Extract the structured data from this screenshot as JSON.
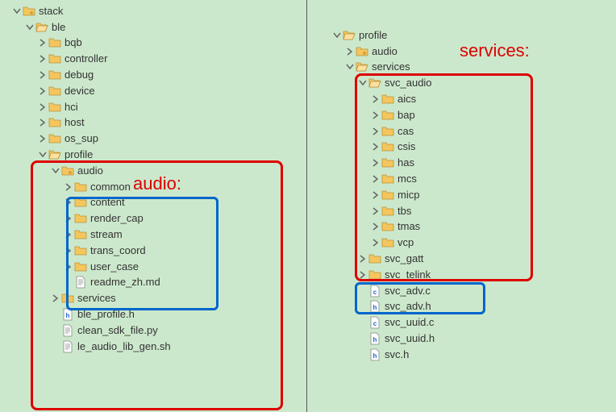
{
  "left": {
    "root": "stack",
    "ble": "ble",
    "c": {
      "bqb": "bqb",
      "controller": "controller",
      "debug": "debug",
      "device": "device",
      "hci": "hci",
      "host": "host",
      "os_sup": "os_sup"
    },
    "profile": "profile",
    "audio": "audio",
    "audio_children": {
      "common": "common",
      "content": "content",
      "render_cap": "render_cap",
      "stream": "stream",
      "trans_coord": "trans_coord",
      "user_case": "user_case"
    },
    "readme": "readme_zh.md",
    "services": "services",
    "files": {
      "ble_profile": "ble_profile.h",
      "clean_sdk": "clean_sdk_file.py",
      "le_audio": "le_audio_lib_gen.sh"
    }
  },
  "right": {
    "profile": "profile",
    "audio": "audio",
    "services": "services",
    "svc_audio": "svc_audio",
    "svc_children": {
      "aics": "aics",
      "bap": "bap",
      "cas": "cas",
      "csis": "csis",
      "has": "has",
      "mcs": "mcs",
      "micp": "micp",
      "tbs": "tbs",
      "tmas": "tmas",
      "vcp": "vcp"
    },
    "svc_gatt": "svc_gatt",
    "svc_telink": "svc_telink",
    "files": {
      "svc_adv_c": "svc_adv.c",
      "svc_adv_h": "svc_adv.h",
      "svc_uuid_c": "svc_uuid.c",
      "svc_uuid_h": "svc_uuid.h",
      "svc_h": "svc.h"
    }
  },
  "annotations": {
    "audio": "audio:",
    "services": "services:"
  }
}
